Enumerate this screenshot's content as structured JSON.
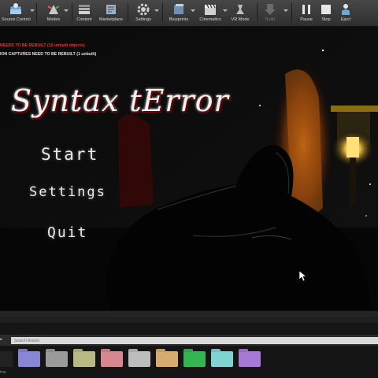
{
  "toolbar": {
    "items": [
      {
        "label": "Source Control",
        "icon": "source-control-icon"
      },
      {
        "label": "Modes",
        "icon": "modes-icon"
      },
      {
        "label": "Content",
        "icon": "content-icon"
      },
      {
        "label": "Marketplace",
        "icon": "marketplace-icon"
      },
      {
        "label": "Settings",
        "icon": "gear-icon"
      },
      {
        "label": "Blueprints",
        "icon": "blueprint-icon"
      },
      {
        "label": "Cinematics",
        "icon": "clapper-icon"
      },
      {
        "label": "VR Mode",
        "icon": "vr-headset-icon"
      },
      {
        "label": "Build",
        "icon": "build-icon"
      },
      {
        "label": "Pause",
        "icon": "pause-icon"
      },
      {
        "label": "Stop",
        "icon": "stop-icon"
      },
      {
        "label": "Eject",
        "icon": "eject-icon"
      }
    ]
  },
  "viewport": {
    "warnings": [
      "NEEDS TO BE REBUILT (10 unbuilt objects)",
      "ION CAPTURES NEED TO BE REBUILT (1 unbuilt)"
    ],
    "warning_colors": [
      "#e23a3a",
      "#e0e0e0"
    ],
    "game_title": "Syntax tError",
    "menu": {
      "start": "Start",
      "settings": "Settings",
      "quit": "Quit"
    }
  },
  "content_browser": {
    "side_label": "►",
    "search_placeholder": "Search Assets",
    "bottom_label": "ms",
    "folder_colors": [
      "#222222",
      "#8a86d6",
      "#9a9a9a",
      "#b9b983",
      "#d68790",
      "#bdbdbd",
      "#d6ad6e",
      "#35b552",
      "#7fd3d1",
      "#a779d6"
    ]
  }
}
